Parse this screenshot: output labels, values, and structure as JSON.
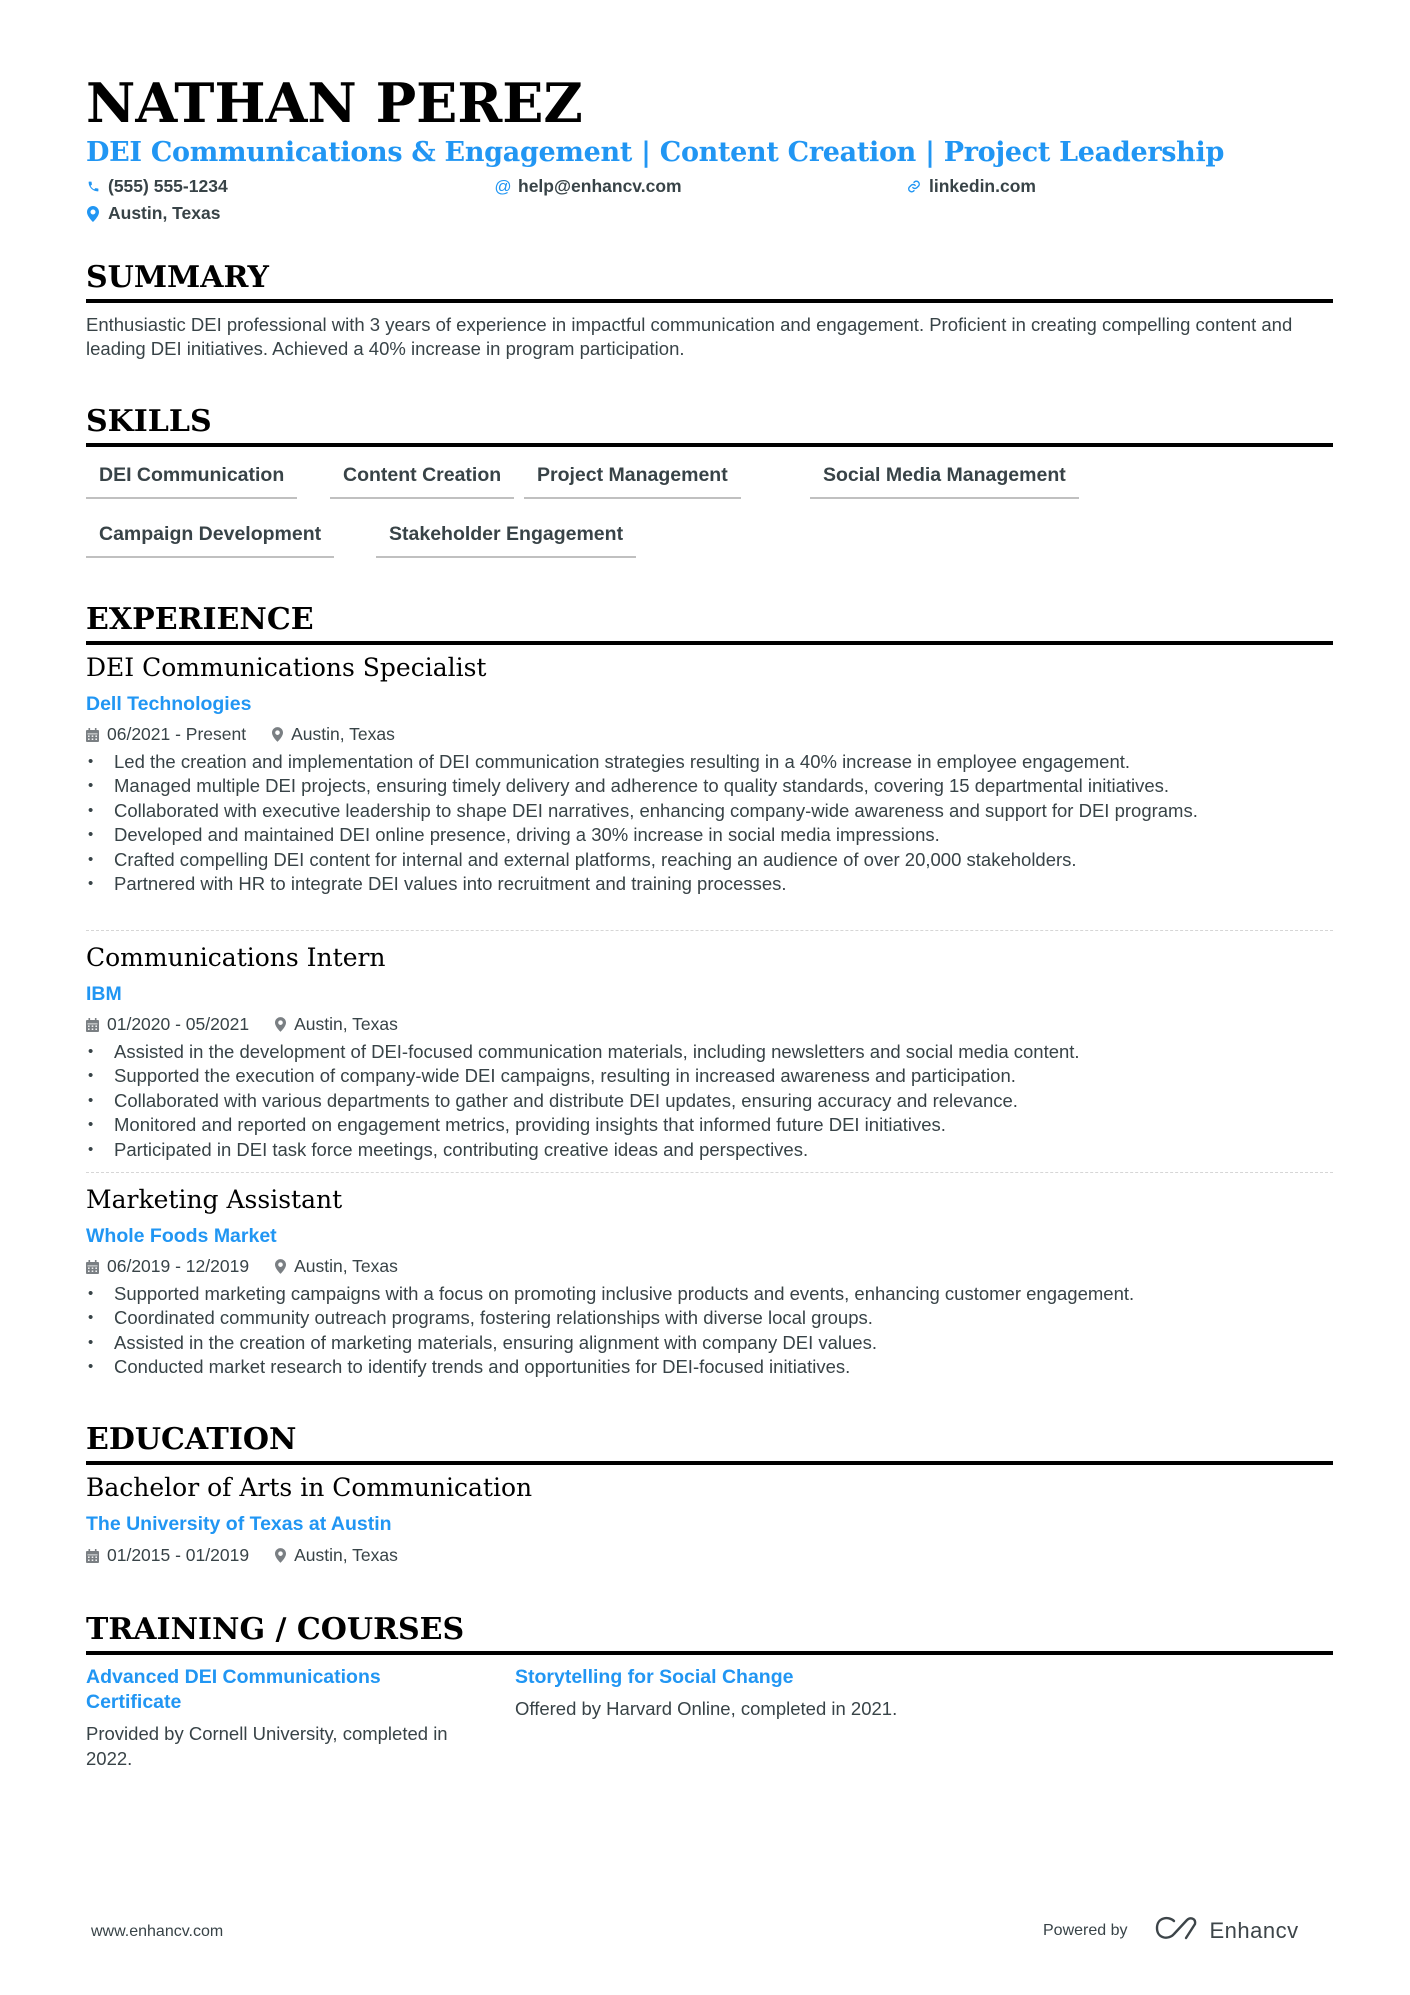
{
  "header": {
    "name": "NATHAN PEREZ",
    "headline": "DEI Communications & Engagement | Content Creation | Project Leadership",
    "contacts": {
      "phone": {
        "icon": "phone-icon",
        "value": "(555) 555-1234"
      },
      "email": {
        "icon": "at-icon",
        "value": "help@enhancv.com"
      },
      "linkedin": {
        "icon": "link-icon",
        "value": "linkedin.com"
      },
      "location": {
        "icon": "map-pin-icon",
        "value": "Austin, Texas"
      }
    }
  },
  "summary": {
    "title": "SUMMARY",
    "text": "Enthusiastic DEI professional with 3 years of experience in impactful communication and engagement. Proficient in creating compelling content and leading DEI initiatives. Achieved a 40% increase in program participation."
  },
  "skills": {
    "title": "SKILLS",
    "items": [
      "DEI Communication",
      "Content Creation",
      "Project Management",
      "Social Media Management",
      "Campaign Development",
      "Stakeholder Engagement"
    ]
  },
  "experience": {
    "title": "EXPERIENCE",
    "jobs": [
      {
        "title": "DEI Communications Specialist",
        "company": "Dell Technologies",
        "dates": "06/2021 - Present",
        "location": "Austin, Texas",
        "bullets": [
          "Led the creation and implementation of DEI communication strategies resulting in a 40% increase in employee engagement.",
          "Managed multiple DEI projects, ensuring timely delivery and adherence to quality standards, covering 15 departmental initiatives.",
          "Collaborated with executive leadership to shape DEI narratives, enhancing company-wide awareness and support for DEI programs.",
          "Developed and maintained DEI online presence, driving a 30% increase in social media impressions.",
          "Crafted compelling DEI content for internal and external platforms, reaching an audience of over 20,000 stakeholders.",
          "Partnered with HR to integrate DEI values into recruitment and training processes."
        ]
      },
      {
        "title": "Communications Intern",
        "company": "IBM",
        "dates": "01/2020 - 05/2021",
        "location": "Austin, Texas",
        "bullets": [
          "Assisted in the development of DEI-focused communication materials, including newsletters and social media content.",
          "Supported the execution of company-wide DEI campaigns, resulting in increased awareness and participation.",
          "Collaborated with various departments to gather and distribute DEI updates, ensuring accuracy and relevance.",
          "Monitored and reported on engagement metrics, providing insights that informed future DEI initiatives.",
          "Participated in DEI task force meetings, contributing creative ideas and perspectives."
        ]
      },
      {
        "title": "Marketing Assistant",
        "company": "Whole Foods Market",
        "dates": "06/2019 - 12/2019",
        "location": "Austin, Texas",
        "bullets": [
          "Supported marketing campaigns with a focus on promoting inclusive products and events, enhancing customer engagement.",
          "Coordinated community outreach programs, fostering relationships with diverse local groups.",
          "Assisted in the creation of marketing materials, ensuring alignment with company DEI values.",
          "Conducted market research to identify trends and opportunities for DEI-focused initiatives."
        ]
      }
    ]
  },
  "education": {
    "title": "EDUCATION",
    "items": [
      {
        "degree": "Bachelor of Arts in Communication",
        "school": "The University of Texas at Austin",
        "dates": "01/2015 - 01/2019",
        "location": "Austin, Texas"
      }
    ]
  },
  "training": {
    "title": "TRAINING / COURSES",
    "items": [
      {
        "title": "Advanced DEI Communications Certificate",
        "description": "Provided by Cornell University, completed in 2022."
      },
      {
        "title": "Storytelling for Social Change",
        "description": "Offered by Harvard Online, completed in 2021."
      }
    ]
  },
  "footer": {
    "website": "www.enhancv.com",
    "powered_by": "Powered by",
    "brand": "Enhancv"
  },
  "colors": {
    "accent": "#2196f3",
    "text": "#384347",
    "heading": "#000000"
  }
}
